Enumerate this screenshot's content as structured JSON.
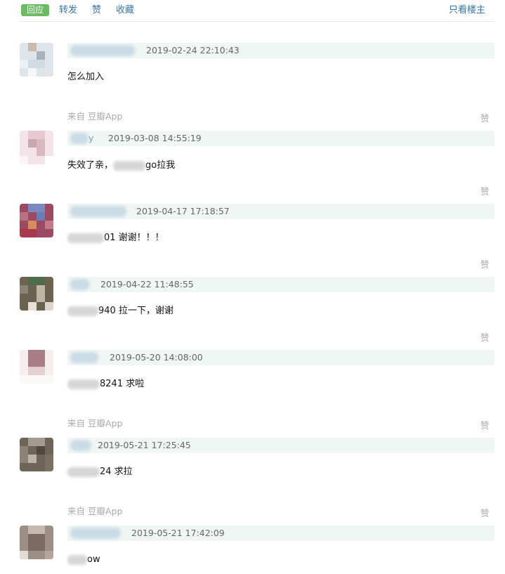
{
  "toolbar": {
    "reply_label": "回应",
    "forward_label": "转发",
    "like_label": "赞",
    "collect_label": "收藏",
    "only_op_label": "只看楼主"
  },
  "like_text": "赞",
  "source_text": "来自 豆瓣App",
  "comments": [
    {
      "name_visible": "",
      "time": "2019-02-24 22:10:43",
      "text_prefix": "",
      "text_suffix": "怎么加入"
    },
    {
      "name_visible": "y",
      "time": "2019-03-08 14:55:19",
      "text_prefix": "失效了亲，",
      "text_suffix": "go拉我"
    },
    {
      "name_visible": "",
      "time": "2019-04-17 17:18:57",
      "text_prefix": "",
      "text_suffix": "01 谢谢！！！"
    },
    {
      "name_visible": "",
      "time": "2019-04-22 11:48:55",
      "text_prefix": "",
      "text_suffix": "940 拉一下，谢谢"
    },
    {
      "name_visible": "",
      "time": "2019-05-20 14:08:00",
      "text_prefix": "",
      "text_suffix": "8241 求啦"
    },
    {
      "name_visible": "",
      "time": "2019-05-21 17:25:45",
      "text_prefix": "",
      "text_suffix": "24 求拉"
    },
    {
      "name_visible": "",
      "time": "2019-05-21 17:42:09",
      "text_prefix": "",
      "text_suffix": "ow"
    }
  ],
  "colors": {
    "accent_green": "#6cbb62",
    "link_blue": "#3377aa",
    "meta_bar": "#f0f6f3",
    "muted_text": "#aaaaaa"
  }
}
